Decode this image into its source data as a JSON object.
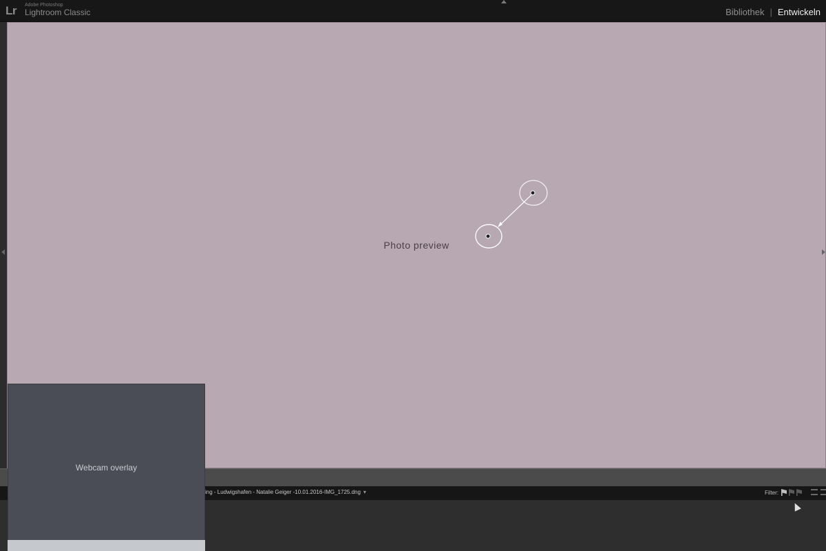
{
  "app": {
    "logo": "Lr",
    "brand_small": "Adobe Photoshop",
    "brand_big": "Lightroom Classic"
  },
  "modules": {
    "library": "Bibliothek",
    "separator": "|",
    "develop": "Entwickeln"
  },
  "photo": {
    "placeholder": "Photo preview"
  },
  "filmstrip": {
    "path": "ing - Ludwigshafen - Natalie Geiger -10.01.2016-IMG_1725.dng",
    "path_caret": "▾",
    "filter_label": "Filter:"
  },
  "webcam": {
    "placeholder": "Webcam overlay"
  },
  "colors": {
    "topbar": "#171717",
    "active_module": "#f0f0f0",
    "inactive_module": "#8e8e8e",
    "panel_bg": "#2e2e2e"
  }
}
